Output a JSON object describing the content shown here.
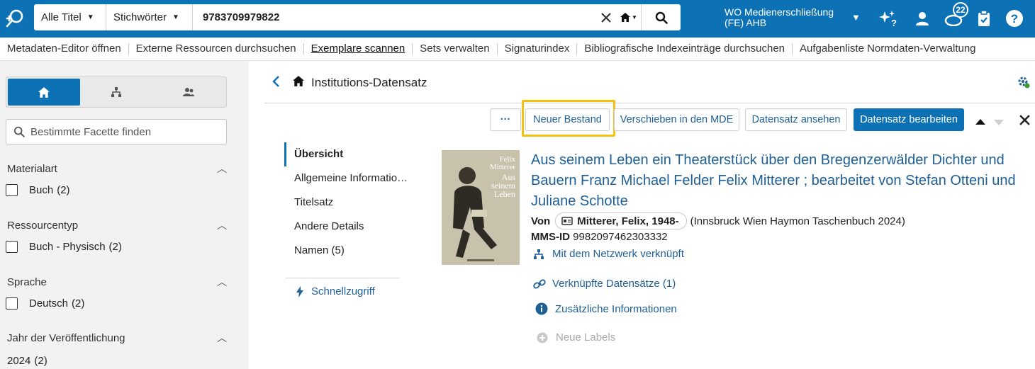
{
  "topbar": {
    "scope_primary": "Alle Titel",
    "scope_secondary": "Stichwörter",
    "search_value": "9783709979822",
    "institution_line1": "WO Medienerschließung",
    "institution_line2": "(FE) AHB",
    "notification_count": "22",
    "brand_color": "#0d72b5"
  },
  "navbar": {
    "items": [
      "Metadaten-Editor öffnen",
      "Externe Ressourcen durchsuchen",
      "Exemplare scannen",
      "Sets verwalten",
      "Signaturindex",
      "Bibliografische Indexeinträge durchsuchen",
      "Aufgabenliste Normdaten-Verwaltung"
    ],
    "active_index": 2
  },
  "sidebar": {
    "facet_search_placeholder": "Bestimmte Facette finden",
    "facets": [
      {
        "title": "Materialart",
        "option": "Buch",
        "count": "(2)"
      },
      {
        "title": "Ressourcentyp",
        "option": "Buch - Physisch",
        "count": "(2)"
      },
      {
        "title": "Sprache",
        "option": "Deutsch",
        "count": "(2)"
      },
      {
        "title": "Jahr der Veröffentlichung",
        "option": "2024",
        "count": "(2)"
      }
    ]
  },
  "main": {
    "title": "Institutions-Datensatz",
    "buttons": {
      "more": "···",
      "new_holding": "Neuer Bestand",
      "move_mde": "Verschieben in den MDE",
      "view_record": "Datensatz ansehen",
      "edit_record": "Datensatz bearbeiten"
    },
    "subnav": {
      "items": [
        "Übersicht",
        "Allgemeine Informatio…",
        "Titelsatz",
        "Andere Details",
        "Namen (5)"
      ],
      "quick_access": "Schnellzugriff"
    },
    "record": {
      "cover_author": [
        "Felix",
        "Mitterer"
      ],
      "cover_title": [
        "Aus",
        "seinem",
        "Leben"
      ],
      "title": "Aus seinem Leben ein Theaterstück über den Bregenzerwälder Dichter und Bauern Franz Michael Felder Felix Mitterer ; bearbeitet von Stefan Otteni und Juliane Schotte",
      "by_label": "Von",
      "author": "Mitterer, Felix, 1948-",
      "publication": "(Innsbruck Wien Haymon Taschenbuch 2024)",
      "mms_label": "MMS-ID",
      "mms_id": "9982097462303332",
      "network_link": "Mit dem Netzwerk verknüpft",
      "linked_records": "Verknüpfte Datensätze (1)",
      "additional_info": "Zusätzliche Informationen",
      "new_labels": "Neue Labels"
    }
  }
}
